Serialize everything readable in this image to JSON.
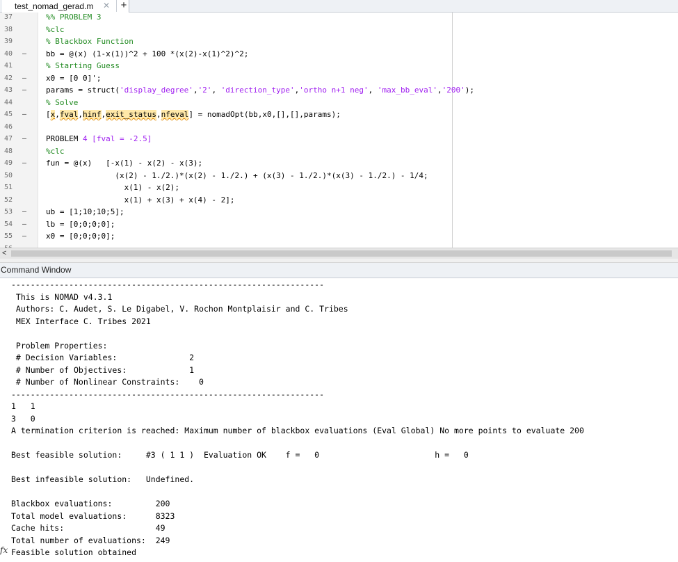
{
  "tab": {
    "title": "test_nomad_gerad.m",
    "close_glyph": "✕",
    "add_glyph": "+"
  },
  "editor": {
    "lines": [
      {
        "num": "37",
        "dash": "",
        "segments": [
          {
            "t": "%% PROBLEM 3",
            "c": "cm"
          }
        ]
      },
      {
        "num": "38",
        "dash": "",
        "segments": [
          {
            "t": "%clc",
            "c": "cm"
          }
        ]
      },
      {
        "num": "39",
        "dash": "",
        "segments": [
          {
            "t": "% Blackbox Function",
            "c": "cm"
          }
        ]
      },
      {
        "num": "40",
        "dash": "–",
        "segments": [
          {
            "t": "bb = @(x) (1-x(1))^2 + 100 *(x(2)-x(1)^2)^2;",
            "c": ""
          }
        ]
      },
      {
        "num": "41",
        "dash": "",
        "segments": [
          {
            "t": "% Starting Guess",
            "c": "cm"
          }
        ]
      },
      {
        "num": "42",
        "dash": "–",
        "segments": [
          {
            "t": "x0 = [0 0]';",
            "c": ""
          }
        ]
      },
      {
        "num": "43",
        "dash": "–",
        "segments": [
          {
            "t": "params = struct(",
            "c": ""
          },
          {
            "t": "'display_degree'",
            "c": "st"
          },
          {
            "t": ",",
            "c": ""
          },
          {
            "t": "'2'",
            "c": "st"
          },
          {
            "t": ", ",
            "c": ""
          },
          {
            "t": "'direction_type'",
            "c": "st"
          },
          {
            "t": ",",
            "c": ""
          },
          {
            "t": "'ortho n+1 neg'",
            "c": "st"
          },
          {
            "t": ", ",
            "c": ""
          },
          {
            "t": "'max_bb_eval'",
            "c": "st"
          },
          {
            "t": ",",
            "c": ""
          },
          {
            "t": "'200'",
            "c": "st"
          },
          {
            "t": ");",
            "c": ""
          }
        ]
      },
      {
        "num": "44",
        "dash": "",
        "segments": [
          {
            "t": "% Solve",
            "c": "cm"
          }
        ]
      },
      {
        "num": "45",
        "dash": "–",
        "segments": [
          {
            "t": "[",
            "c": ""
          },
          {
            "t": "x",
            "c": "hl sq"
          },
          {
            "t": ",",
            "c": ""
          },
          {
            "t": "fval",
            "c": "hl sq"
          },
          {
            "t": ",",
            "c": ""
          },
          {
            "t": "hinf",
            "c": "hl sq"
          },
          {
            "t": ",",
            "c": ""
          },
          {
            "t": "exit_status",
            "c": "hl sq"
          },
          {
            "t": ",",
            "c": ""
          },
          {
            "t": "nfeval",
            "c": "hl sq"
          },
          {
            "t": "] = nomadOpt(bb,x0,[],[],params);",
            "c": ""
          }
        ]
      },
      {
        "num": "46",
        "dash": "",
        "segments": [
          {
            "t": "",
            "c": ""
          }
        ]
      },
      {
        "num": "47",
        "dash": "–",
        "segments": [
          {
            "t": "PROBLEM ",
            "c": ""
          },
          {
            "t": "4 [fval = -2.5]",
            "c": "st"
          }
        ]
      },
      {
        "num": "48",
        "dash": "",
        "segments": [
          {
            "t": "%clc",
            "c": "cm"
          }
        ]
      },
      {
        "num": "49",
        "dash": "–",
        "segments": [
          {
            "t": "fun = @(x)   [-x(1) - x(2) - x(3);",
            "c": ""
          }
        ]
      },
      {
        "num": "50",
        "dash": "",
        "segments": [
          {
            "t": "               (x(2) - 1./2.)*(x(2) - 1./2.) + (x(3) - 1./2.)*(x(3) - 1./2.) - 1/4;",
            "c": ""
          }
        ]
      },
      {
        "num": "51",
        "dash": "",
        "segments": [
          {
            "t": "                 x(1) - x(2);",
            "c": ""
          }
        ]
      },
      {
        "num": "52",
        "dash": "",
        "segments": [
          {
            "t": "                 x(1) + x(3) + x(4) - 2];",
            "c": ""
          }
        ]
      },
      {
        "num": "53",
        "dash": "–",
        "segments": [
          {
            "t": "ub = [1;10;10;5];",
            "c": ""
          }
        ]
      },
      {
        "num": "54",
        "dash": "–",
        "segments": [
          {
            "t": "lb = [0;0;0;0];",
            "c": ""
          }
        ]
      },
      {
        "num": "55",
        "dash": "–",
        "segments": [
          {
            "t": "x0 = [0;0;0;0];",
            "c": ""
          }
        ]
      },
      {
        "num": "56",
        "dash": "",
        "segments": [
          {
            "t": "",
            "c": ""
          }
        ]
      }
    ]
  },
  "scrollbar": {
    "left_arrow": "<"
  },
  "command_window": {
    "title": "Command Window",
    "prompt_glyph": "fx",
    "lines": [
      "-----------------------------------------------------------------",
      " This is NOMAD v4.3.1",
      " Authors: C. Audet, S. Le Digabel, V. Rochon Montplaisir and C. Tribes",
      " MEX Interface C. Tribes 2021",
      "",
      " Problem Properties:",
      " # Decision Variables:               2",
      " # Number of Objectives:             1",
      " # Number of Nonlinear Constraints:    0",
      "-----------------------------------------------------------------",
      "1   1",
      "3   0",
      "A termination criterion is reached: Maximum number of blackbox evaluations (Eval Global) No more points to evaluate 200",
      "",
      "Best feasible solution:     #3 ( 1 1 )  Evaluation OK    f =   0                        h =   0",
      "",
      "Best infeasible solution:   Undefined.",
      "",
      "Blackbox evaluations:         200",
      "Total model evaluations:      8323",
      "Cache hits:                   49",
      "Total number of evaluations:  249",
      "Feasible solution obtained"
    ]
  }
}
